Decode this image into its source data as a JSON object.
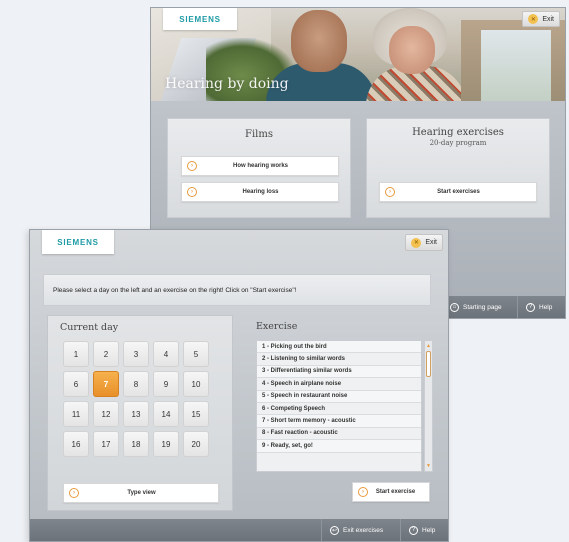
{
  "back_window": {
    "logo": "SIEMENS",
    "exit_label": "Exit",
    "hero_title": "Hearing by doing",
    "films": {
      "title": "Films",
      "buttons": [
        "How hearing works",
        "Hearing loss"
      ]
    },
    "hearing_exercises": {
      "title": "Hearing exercises",
      "subtitle": "20-day program",
      "start_button": "Start exercises"
    },
    "footer": {
      "starting_page": "Starting page",
      "help": "Help"
    }
  },
  "front_window": {
    "logo": "SIEMENS",
    "exit_label": "Exit",
    "instruction": "Please select a day on the left and an exercise on the right! Click on \"Start exercise\"!",
    "current_day": {
      "title": "Current day",
      "days": [
        "1",
        "2",
        "3",
        "4",
        "5",
        "6",
        "7",
        "8",
        "9",
        "10",
        "11",
        "12",
        "13",
        "14",
        "15",
        "16",
        "17",
        "18",
        "19",
        "20"
      ],
      "selected_day": "7",
      "type_view_button": "Type view"
    },
    "exercise": {
      "title": "Exercise",
      "items": [
        "1 - Picking out the bird",
        "2 - Listening to similar words",
        "3 - Differentiating similar words",
        "4 - Speech in airplane noise",
        "5 - Speech in restaurant noise",
        "6 - Competing Speech",
        "7 - Short term memory - acoustic",
        "8 - Fast reaction - acoustic",
        "9 - Ready, set, go!"
      ],
      "start_button": "Start exercise"
    },
    "footer": {
      "exit_exercises": "Exit exercises",
      "help": "Help"
    }
  },
  "colors": {
    "accent_orange": "#e89a3c",
    "siemens_teal": "#1f9ba6",
    "footer_gray": "#737980"
  }
}
